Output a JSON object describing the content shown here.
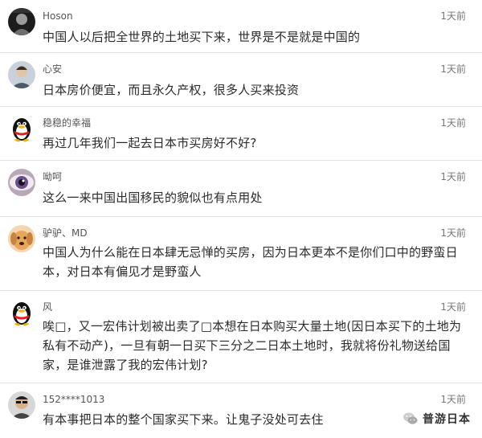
{
  "comments": [
    {
      "username": "Hoson",
      "time": "1天前",
      "text": "中国人以后把全世界的土地买下来，世界是不是就是中国的",
      "avatar": "dark-portrait-icon"
    },
    {
      "username": "心安",
      "time": "1天前",
      "text": "日本房价便宜，而且永久产权，很多人买来投资",
      "avatar": "person-photo-icon"
    },
    {
      "username": "稳稳的幸福",
      "time": "1天前",
      "text": "再过几年我们一起去日本市买房好不好?",
      "avatar": "qq-penguin-icon"
    },
    {
      "username": "呦呵",
      "time": "1天前",
      "text": "这么一来中国出国移民的貌似也有点用处",
      "avatar": "eye-closeup-icon"
    },
    {
      "username": "驴驴、MD",
      "time": "1天前",
      "text": "中国人为什么能在日本肆无忌惮的买房，因为日本更本不是你们口中的野蛮日本，对日本有偏见才是野蛮人",
      "avatar": "dog-photo-icon"
    },
    {
      "username": "风",
      "time": "1天前",
      "text": "唉□，又一宏伟计划被出卖了□本想在日本购买大量土地(因日本买下的土地为私有不动产)，一旦有朝一日买下三分之二日本土地时，我就将份礼物送给国家，是谁泄露了我的宏伟计划?",
      "avatar": "qq-penguin-icon"
    },
    {
      "username": "152****1013",
      "time": "1天前",
      "text": "有本事把日本的整个国家买下来。让鬼子没处可去住",
      "avatar": "sunglasses-portrait-icon"
    }
  ],
  "watermark": {
    "text": "普游日本",
    "icon": "wechat-icon"
  }
}
